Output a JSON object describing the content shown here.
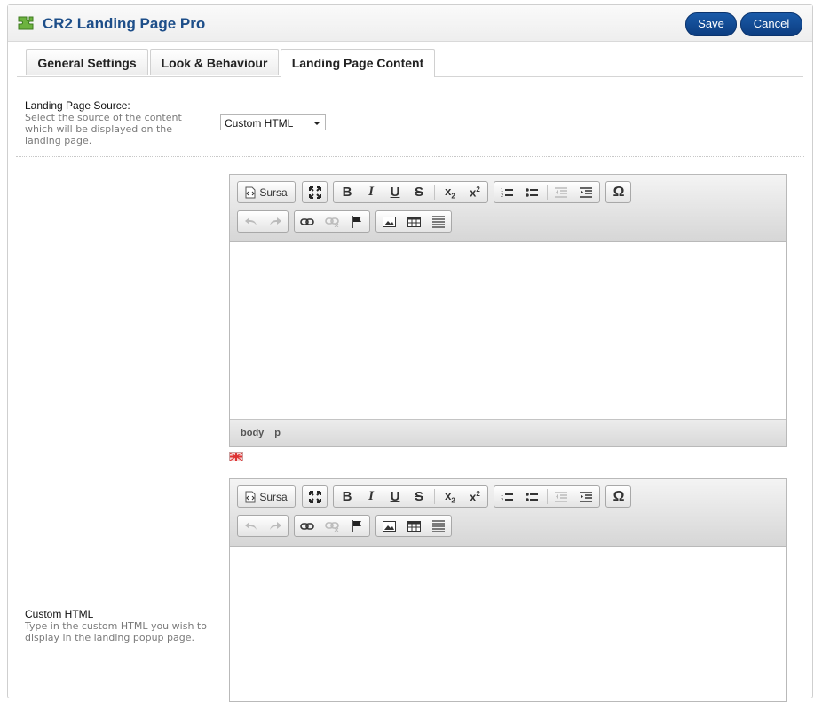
{
  "header": {
    "title": "CR2 Landing Page Pro",
    "save_label": "Save",
    "cancel_label": "Cancel"
  },
  "tabs": [
    {
      "label": "General Settings"
    },
    {
      "label": "Look & Behaviour"
    },
    {
      "label": "Landing Page Content"
    }
  ],
  "source_field": {
    "title": "Landing Page Source:",
    "description": "Select the source of the content which will be displayed on the landing page.",
    "selected": "Custom HTML"
  },
  "editor_toolbar": {
    "source_label": "Sursa"
  },
  "editor1_status": {
    "path": [
      "body",
      "p"
    ]
  },
  "custom_html_field": {
    "title": "Custom HTML",
    "description": "Type in the custom HTML you wish to display in the landing popup page."
  },
  "colors": {
    "accent": "#1d4e89",
    "button": "#0c3d80"
  }
}
